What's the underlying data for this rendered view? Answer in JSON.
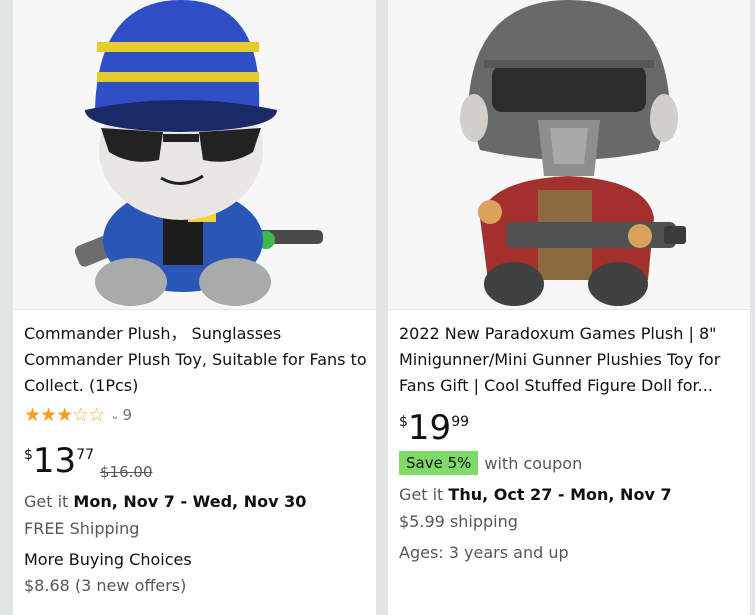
{
  "products": [
    {
      "title": "Commander Plush，  Sunglasses Commander Plush Toy, Suitable for Fans to Collect. (1Pcs)",
      "rating_stars": 3,
      "rating_count": "9",
      "price": {
        "symbol": "$",
        "whole": "13",
        "fraction": "77",
        "list_price": "$16.00"
      },
      "delivery_prefix": "Get it ",
      "delivery_dates": "Mon, Nov 7 - Wed, Nov 30",
      "shipping": "FREE Shipping",
      "more_choices_label": "More Buying Choices",
      "more_choices_price": "$8.68",
      "more_choices_offers": " (3 new offers)"
    },
    {
      "title": "2022 New Paradoxum Games Plush | 8\" Minigunner/Mini Gunner Plushies Toy for Fans Gift | Cool Stuffed Figure Doll for...",
      "price": {
        "symbol": "$",
        "whole": "19",
        "fraction": "99"
      },
      "coupon_badge": "Save 5%",
      "coupon_text": "with coupon",
      "delivery_prefix": "Get it ",
      "delivery_dates": "Thu, Oct 27 - Mon, Nov 7",
      "shipping": "$5.99 shipping",
      "ages": "Ages: 3 years and up"
    }
  ],
  "icons": {
    "star_full": "★",
    "star_empty": "☆",
    "chevron": "⌄"
  },
  "colors": {
    "star": "#f19e22",
    "coupon_badge": "#7fda69",
    "muted_text": "#565959"
  }
}
